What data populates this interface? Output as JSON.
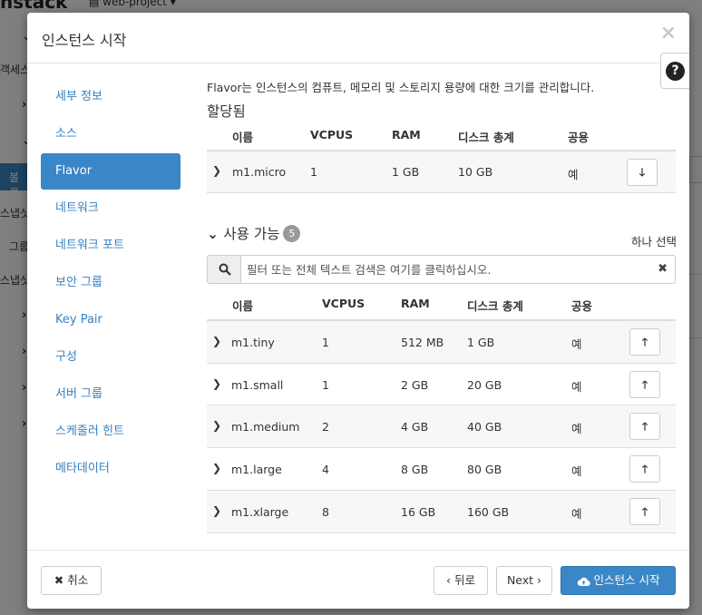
{
  "background": {
    "logo": "nstack",
    "project": "web-project",
    "sidebar": [
      "객세스",
      "볼륨",
      "스냅샷",
      "그룹",
      "스냅샷"
    ]
  },
  "modal": {
    "title": "인스턴스 시작",
    "close": "×",
    "help": "?"
  },
  "nav": [
    {
      "label": "세부 정보"
    },
    {
      "label": "소스"
    },
    {
      "label": "Flavor"
    },
    {
      "label": "네트워크"
    },
    {
      "label": "네트워크 포트"
    },
    {
      "label": "보안 그룹"
    },
    {
      "label": "Key Pair"
    },
    {
      "label": "구성"
    },
    {
      "label": "서버 그룹"
    },
    {
      "label": "스케줄러 힌트"
    },
    {
      "label": "메타데이터"
    }
  ],
  "flavor": {
    "intro": "Flavor는 인스턴스의 컴퓨트, 메모리 및 스토리지 용량에 대한 크기를 관리합니다.",
    "allocated_title": "할당됨",
    "available_title": "사용 가능",
    "available_count": "5",
    "select_one": "하나 선택",
    "filter_placeholder": "필터 또는 전체 텍스트 검색은 여기를 클릭하십시오.",
    "columns": {
      "name": "이름",
      "vcpus": "VCPUS",
      "ram": "RAM",
      "disk": "디스크 총계",
      "public": "공용"
    },
    "allocated": [
      {
        "name": "m1.micro",
        "vcpus": "1",
        "ram": "1 GB",
        "disk": "10 GB",
        "public": "예"
      }
    ],
    "available": [
      {
        "name": "m1.tiny",
        "vcpus": "1",
        "ram": "512 MB",
        "disk": "1 GB",
        "public": "예"
      },
      {
        "name": "m1.small",
        "vcpus": "1",
        "ram": "2 GB",
        "disk": "20 GB",
        "public": "예"
      },
      {
        "name": "m1.medium",
        "vcpus": "2",
        "ram": "4 GB",
        "disk": "40 GB",
        "public": "예"
      },
      {
        "name": "m1.large",
        "vcpus": "4",
        "ram": "8 GB",
        "disk": "80 GB",
        "public": "예"
      },
      {
        "name": "m1.xlarge",
        "vcpus": "8",
        "ram": "16 GB",
        "disk": "160 GB",
        "public": "예"
      }
    ]
  },
  "footer": {
    "cancel": "취소",
    "back": "‹ 뒤로",
    "next": "Next ›",
    "launch": "인스턴스 시작"
  },
  "colors": {
    "accent": "#3b86c6",
    "link": "#3880c0"
  }
}
